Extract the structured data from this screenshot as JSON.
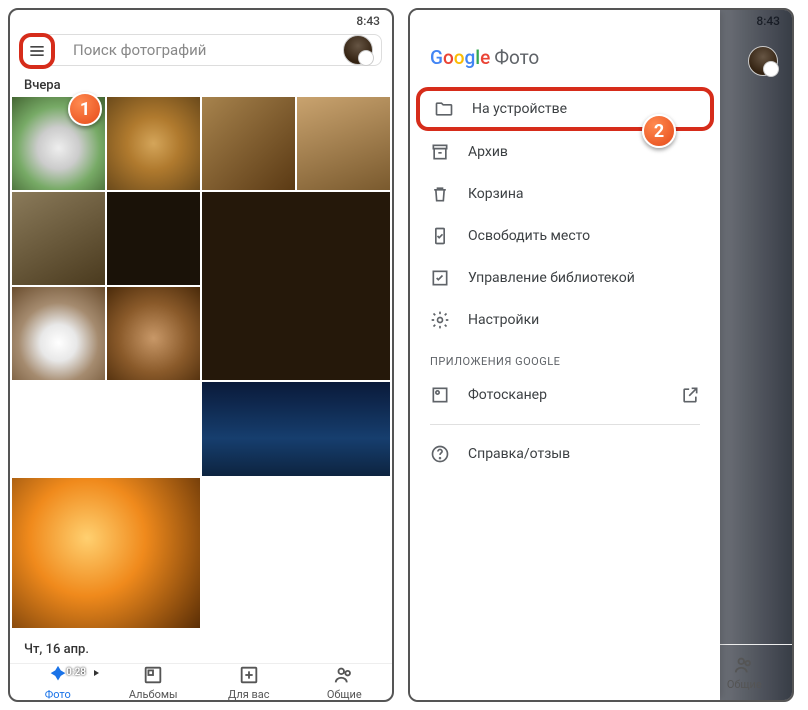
{
  "status": {
    "time": "8:43"
  },
  "search": {
    "placeholder": "Поиск фотографий"
  },
  "sections": {
    "yesterday": "Вчера",
    "date2": "Чт, 16 апр."
  },
  "video": {
    "duration": "0:28"
  },
  "nav": {
    "photos": "Фото",
    "albums": "Альбомы",
    "foryou": "Для вас",
    "shared": "Общие"
  },
  "drawer": {
    "logo_rest": "Фото",
    "on_device": "На устройстве",
    "archive": "Архив",
    "trash": "Корзина",
    "free_space": "Освободить место",
    "manage_lib": "Управление библиотекой",
    "settings": "Настройки",
    "google_apps": "ПРИЛОЖЕНИЯ GOOGLE",
    "photoscan": "Фотосканер",
    "help": "Справка/отзыв"
  },
  "callouts": {
    "one": "1",
    "two": "2"
  }
}
